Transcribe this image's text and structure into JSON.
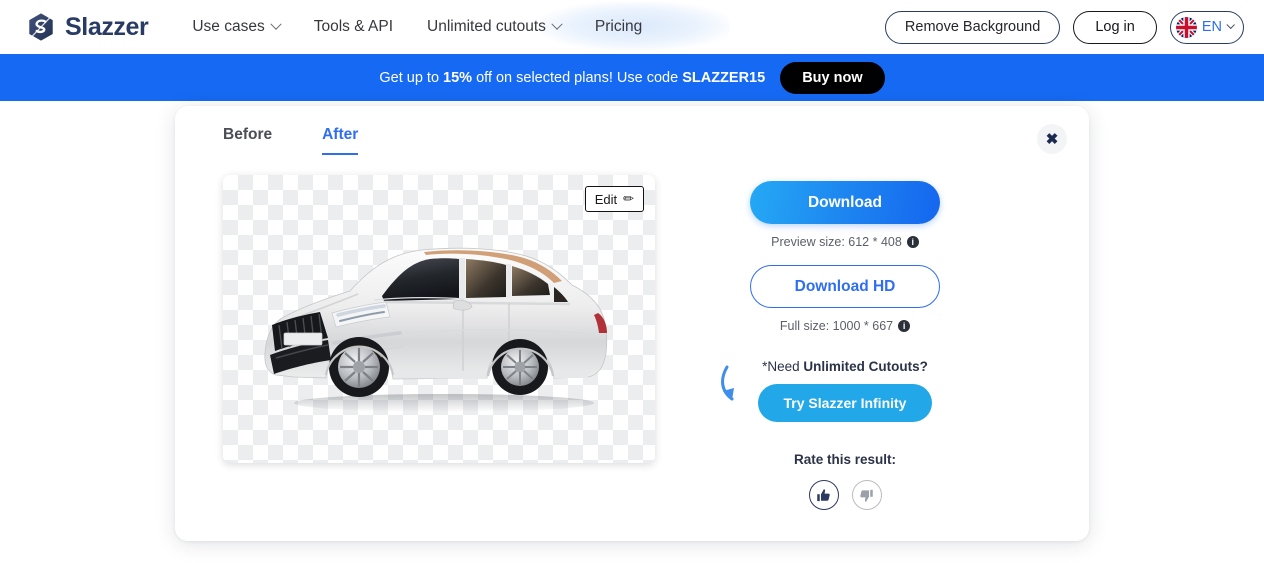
{
  "header": {
    "brand": "Slazzer",
    "brand_icon": "slazzer-diamond-logo",
    "nav": [
      {
        "label": "Use cases",
        "has_chevron": true
      },
      {
        "label": "Tools & API",
        "has_chevron": false
      },
      {
        "label": "Unlimited cutouts",
        "has_chevron": true
      },
      {
        "label": "Pricing",
        "has_chevron": false
      }
    ],
    "remove_background_label": "Remove Background",
    "login_label": "Log in",
    "language": "EN",
    "language_flag_icon": "uk-flag-icon"
  },
  "banner": {
    "text_before": "Get up to ",
    "percent": "15%",
    "text_middle": " off on selected plans! Use code ",
    "code": "SLAZZER15",
    "buy_label": "Buy now",
    "background_color": "#1669f2"
  },
  "card": {
    "tabs": [
      {
        "label": "Before",
        "active": false
      },
      {
        "label": "After",
        "active": true
      }
    ],
    "close_icon": "close-icon",
    "close_glyph": "✖",
    "preview": {
      "edit_label": "Edit",
      "edit_icon": "pencil-icon",
      "edit_glyph": "✏",
      "image_subject": "white Volvo XC90 SUV on transparent checkerboard background"
    },
    "actions": {
      "download_label": "Download",
      "preview_size_text": "Preview size: 612 * 408",
      "preview_info_glyph": "i",
      "download_hd_label": "Download HD",
      "full_size_text": "Full size: 1000 * 667",
      "full_info_glyph": "i",
      "need_prefix": "*Need ",
      "need_bold": "Unlimited Cutouts?",
      "infinity_label": "Try Slazzer Infinity",
      "arrow_icon": "curved-arrow-icon",
      "rate_label": "Rate this result:",
      "thumb_up_icon": "thumbs-up-icon",
      "thumb_up_glyph": "👍",
      "thumb_down_icon": "thumbs-down-icon",
      "thumb_down_glyph": "👎"
    }
  },
  "colors": {
    "accent_blue": "#2f6ef0",
    "banner_blue": "#1669f2",
    "brand_navy": "#283b64",
    "infinity_blue": "#22a7e8"
  }
}
